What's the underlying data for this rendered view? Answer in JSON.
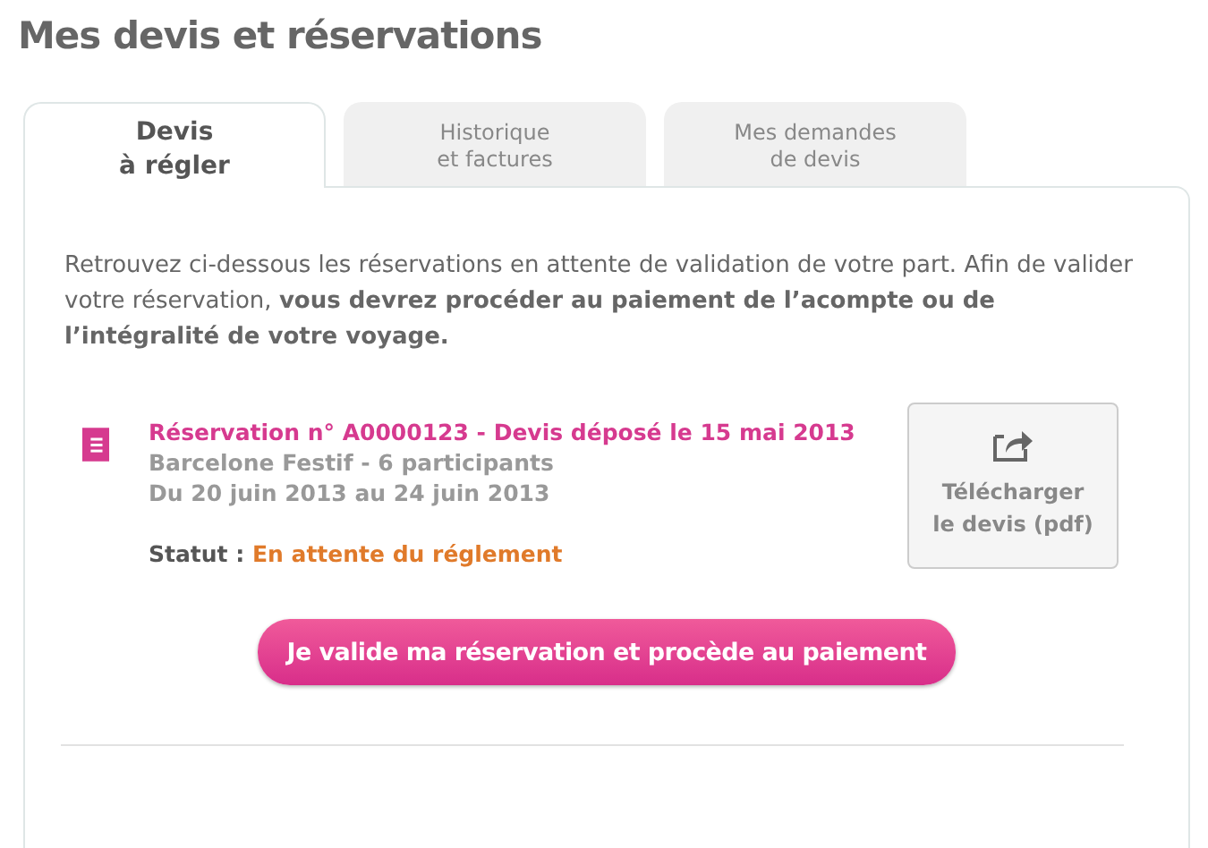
{
  "page_title": "Mes devis et réservations",
  "tabs": [
    {
      "label": "Devis\nà régler",
      "selected": true
    },
    {
      "label": "Historique\net factures",
      "selected": false
    },
    {
      "label": "Mes demandes\nde devis",
      "selected": false
    }
  ],
  "intro": "Retrouvez ci-dessous les réservations en attente de validation de votre part. Afin de valider votre réservation, **vous devrez procéder au paiement de l’acompte ou de l’intégralité de votre voyage.**",
  "reservation": {
    "heading": "Réservation n° A0000123 - Devis déposé le 15 mai 2013",
    "trip": "Barcelone Festif - 6 participants",
    "dates": "Du 20 juin 2013 au 24 juin 2013",
    "status_label": "Statut :",
    "status": "En attente du réglement",
    "download": "Télécharger\nle devis (pdf)"
  },
  "pay_button": "Je valide ma réservation et procède au paiement"
}
